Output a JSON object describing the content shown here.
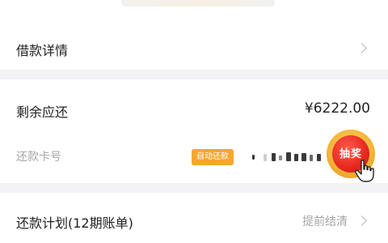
{
  "loan_details": {
    "label": "借款详情"
  },
  "balance": {
    "label": "剩余应还",
    "amount": "¥6222.00"
  },
  "card": {
    "label": "还款卡号",
    "auto_badge": "自动还款"
  },
  "lottery": {
    "label": "抽奖"
  },
  "plan": {
    "label": "还款计划(12期账单)",
    "action": "提前结清"
  },
  "colors": {
    "background": "#f3f3f5",
    "accent_orange": "#f5a62e",
    "lottery_red": "#e6281f",
    "muted_text": "#a6a6a6"
  },
  "icons": [
    "chevron-right-icon",
    "hand-pointer-icon"
  ]
}
